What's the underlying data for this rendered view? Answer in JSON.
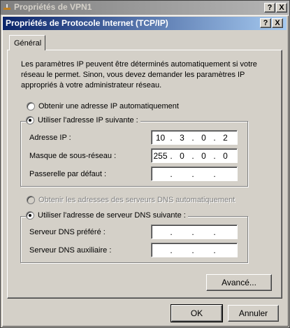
{
  "outer_window": {
    "title": "Propriétés de VPN1",
    "help_label": "?",
    "close_label": "X"
  },
  "dialog": {
    "title": "Propriétés de Protocole Internet (TCP/IP)",
    "help_label": "?",
    "close_label": "X",
    "tab_label": "Général",
    "intro_text": "Les paramètres IP peuvent être déterminés automatiquement si votre réseau le permet. Sinon, vous devez demander les paramètres IP appropriés à votre administrateur réseau.",
    "ip": {
      "auto_option": "Obtenir une adresse IP automatiquement",
      "manual_option": "Utiliser l'adresse IP suivante :",
      "address_label": "Adresse IP :",
      "address_value": [
        "10",
        "3",
        "0",
        "2"
      ],
      "mask_label": "Masque de sous-réseau :",
      "mask_value": [
        "255",
        "0",
        "0",
        "0"
      ],
      "gateway_label": "Passerelle par défaut :",
      "gateway_value": [
        "",
        "",
        "",
        ""
      ]
    },
    "dns": {
      "auto_option": "Obtenir les adresses des serveurs DNS automatiquement",
      "manual_option": "Utiliser l'adresse de serveur DNS suivante :",
      "preferred_label": "Serveur DNS préféré :",
      "preferred_value": [
        "",
        "",
        "",
        ""
      ],
      "alternate_label": "Serveur DNS auxiliaire :",
      "alternate_value": [
        "",
        "",
        "",
        ""
      ]
    },
    "advanced_button": "Avancé...",
    "ok_button": "OK",
    "cancel_button": "Annuler",
    "separator": "."
  },
  "colors": {
    "title_active": "#0a246a",
    "title_inactive": "#808080",
    "face": "#d4d0c8"
  }
}
